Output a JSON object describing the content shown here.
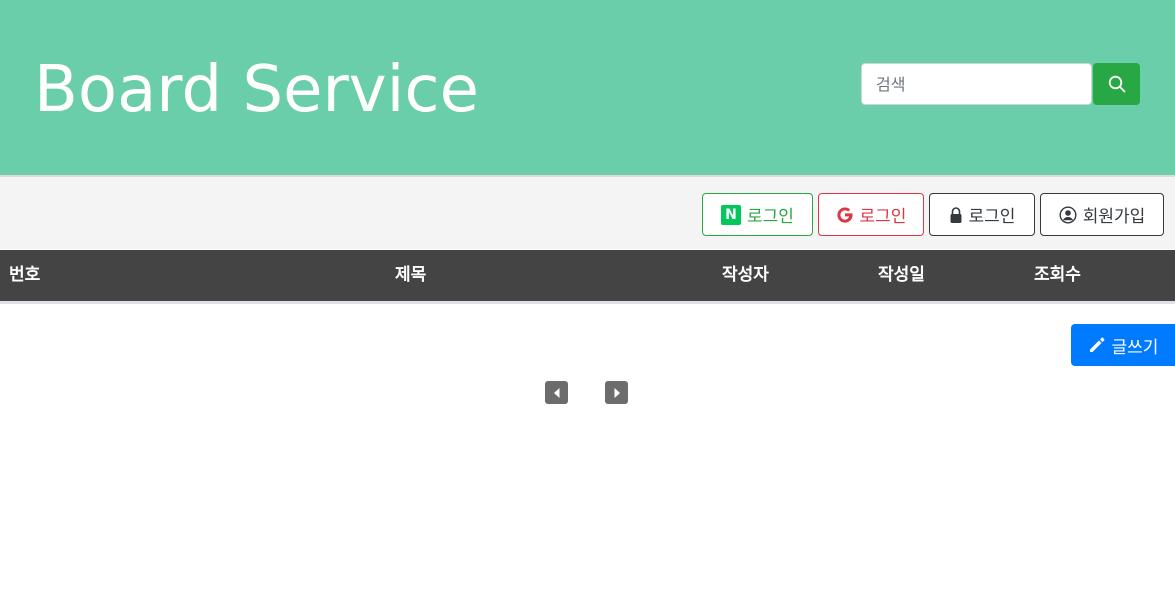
{
  "header": {
    "title": "Board Service",
    "search": {
      "placeholder": "검색",
      "value": ""
    },
    "search_icon": "search-icon"
  },
  "auth": {
    "naver_label": "로그인",
    "naver_badge": "N",
    "google_label": "로그인",
    "login_label": "로그인",
    "signup_label": "회원가입"
  },
  "table": {
    "columns": [
      "번호",
      "제목",
      "작성자",
      "작성일",
      "조회수"
    ],
    "rows": []
  },
  "actions": {
    "write_label": "글쓰기"
  },
  "pagination": {
    "prev_icon": "caret-left-icon",
    "next_icon": "caret-right-icon"
  },
  "colors": {
    "header_bg": "#69cea9",
    "table_head_bg": "#444444",
    "write_btn": "#007bff",
    "search_btn": "#28a745",
    "naver": "#28a745",
    "google": "#dc3545"
  }
}
